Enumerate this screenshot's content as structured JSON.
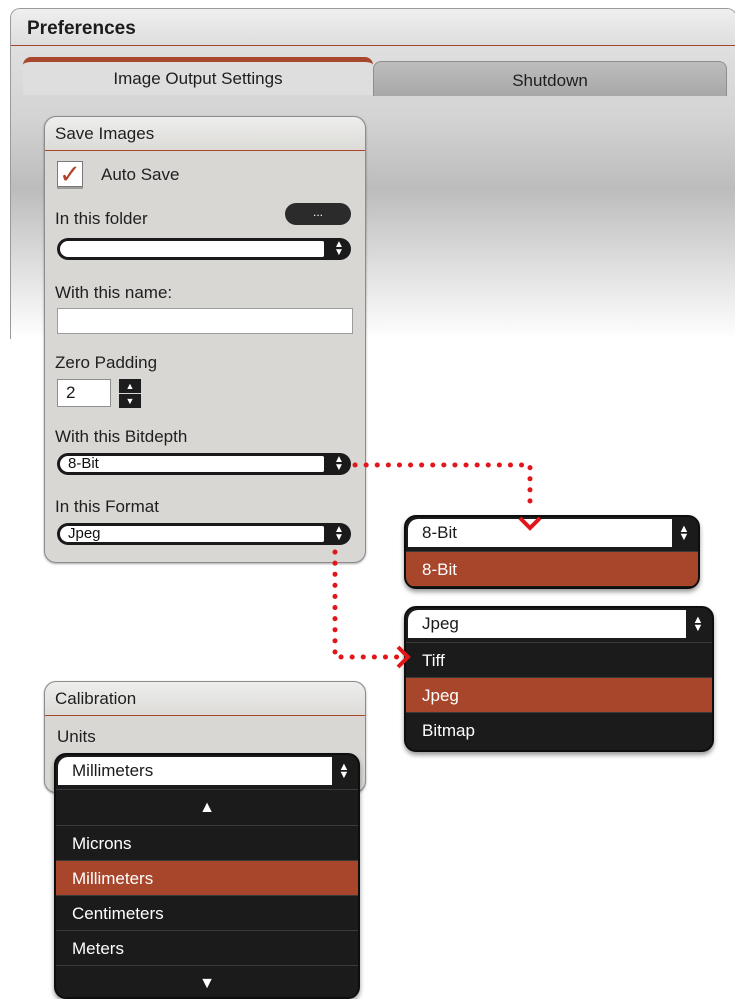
{
  "window": {
    "title": "Preferences"
  },
  "tabs": [
    {
      "label": "Image Output Settings",
      "active": true
    },
    {
      "label": "Shutdown",
      "active": false
    }
  ],
  "save_images": {
    "title": "Save Images",
    "auto_save": {
      "label": "Auto Save",
      "checked": true,
      "check_glyph": "✓"
    },
    "folder_label": "In this folder",
    "browse_button": "...",
    "folder_value": "",
    "name_label": "With this name:",
    "name_value": "",
    "zero_padding_label": "Zero Padding",
    "zero_padding_value": "2",
    "bitdepth_label": "With this Bitdepth",
    "bitdepth_value": "8-Bit",
    "format_label": "In this Format",
    "format_value": "Jpeg"
  },
  "bitdepth_dropdown": {
    "selected": "8-Bit",
    "options": [
      "8-Bit"
    ]
  },
  "format_dropdown": {
    "selected": "Jpeg",
    "options": [
      "Tiff",
      "Jpeg",
      "Bitmap"
    ]
  },
  "calibration": {
    "title": "Calibration",
    "units_label": "Units",
    "units_value": "Millimeters",
    "options": [
      "Microns",
      "Millimeters",
      "Centimeters",
      "Meters"
    ]
  },
  "colors": {
    "accent": "#a8462c",
    "dark": "#1b1b1b",
    "connector": "#e0161b"
  }
}
